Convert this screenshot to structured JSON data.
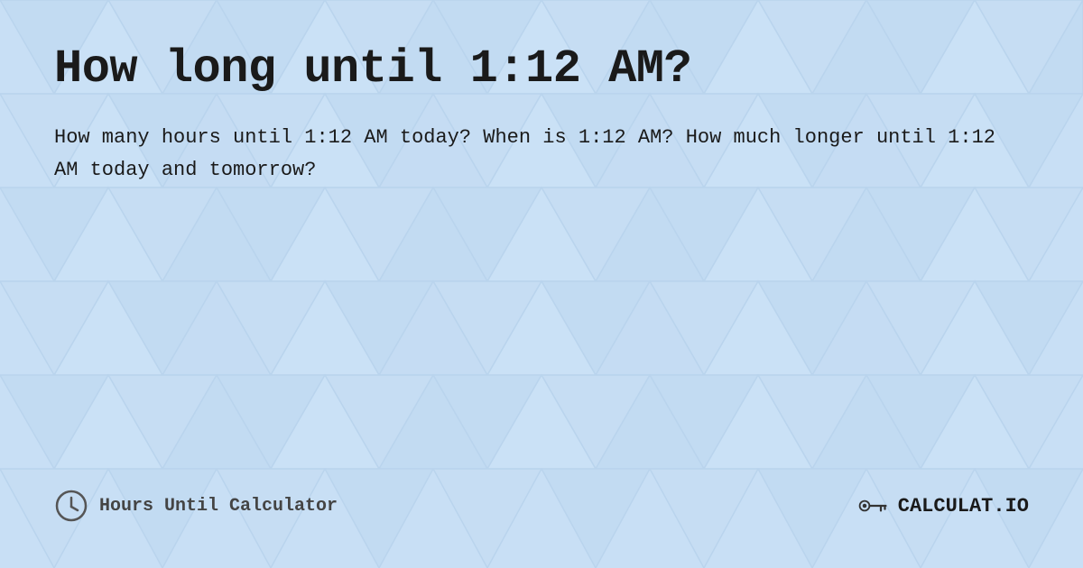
{
  "page": {
    "title": "How long until 1:12 AM?",
    "description": "How many hours until 1:12 AM today? When is 1:12 AM? How much longer until 1:12 AM today and tomorrow?",
    "footer": {
      "left_icon": "clock-icon",
      "left_text": "Hours Until Calculator",
      "right_brand": "CALCULAT.IO"
    }
  },
  "colors": {
    "background": "#c8dff5",
    "title": "#1a1a1a",
    "text": "#1a1a1a",
    "footer_text": "#444444"
  }
}
